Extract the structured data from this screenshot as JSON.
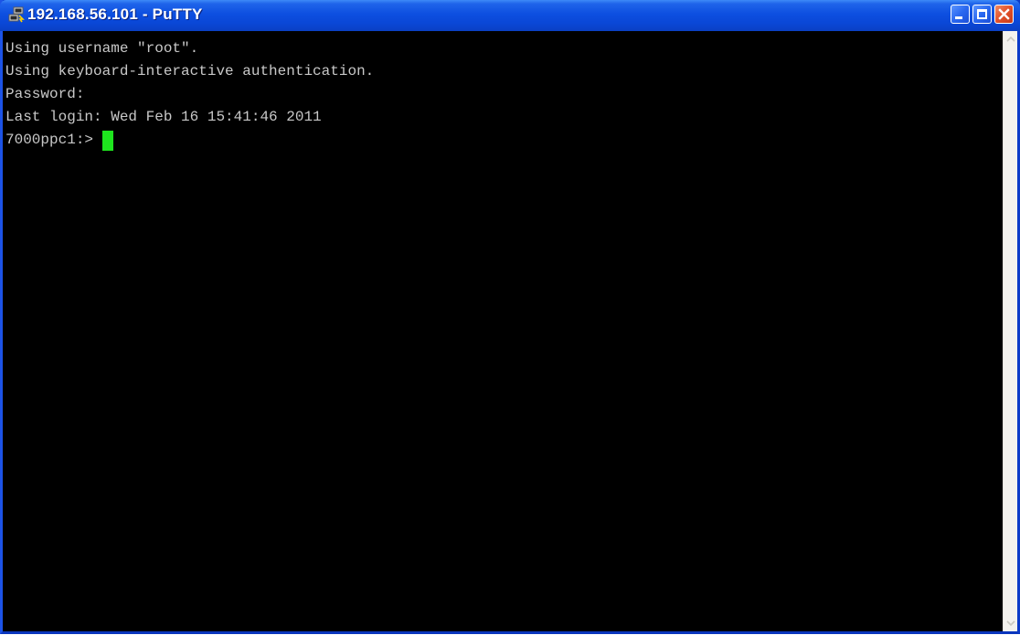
{
  "window": {
    "title": "192.168.56.101 - PuTTY",
    "app_icon": "putty-icon",
    "controls": {
      "minimize_icon": "minimize-icon",
      "maximize_icon": "maximize-icon",
      "close_icon": "close-icon"
    }
  },
  "terminal": {
    "lines": [
      "Using username \"root\".",
      "Using keyboard-interactive authentication.",
      "Password:",
      "Last login: Wed Feb 16 15:41:46 2011"
    ],
    "prompt": "7000ppc1:>",
    "text_color": "#c8c8c8",
    "background_color": "#000000",
    "cursor_color": "#1ee51e"
  },
  "scrollbar": {
    "up_icon": "scroll-up-arrow-icon",
    "down_icon": "scroll-down-arrow-icon"
  }
}
